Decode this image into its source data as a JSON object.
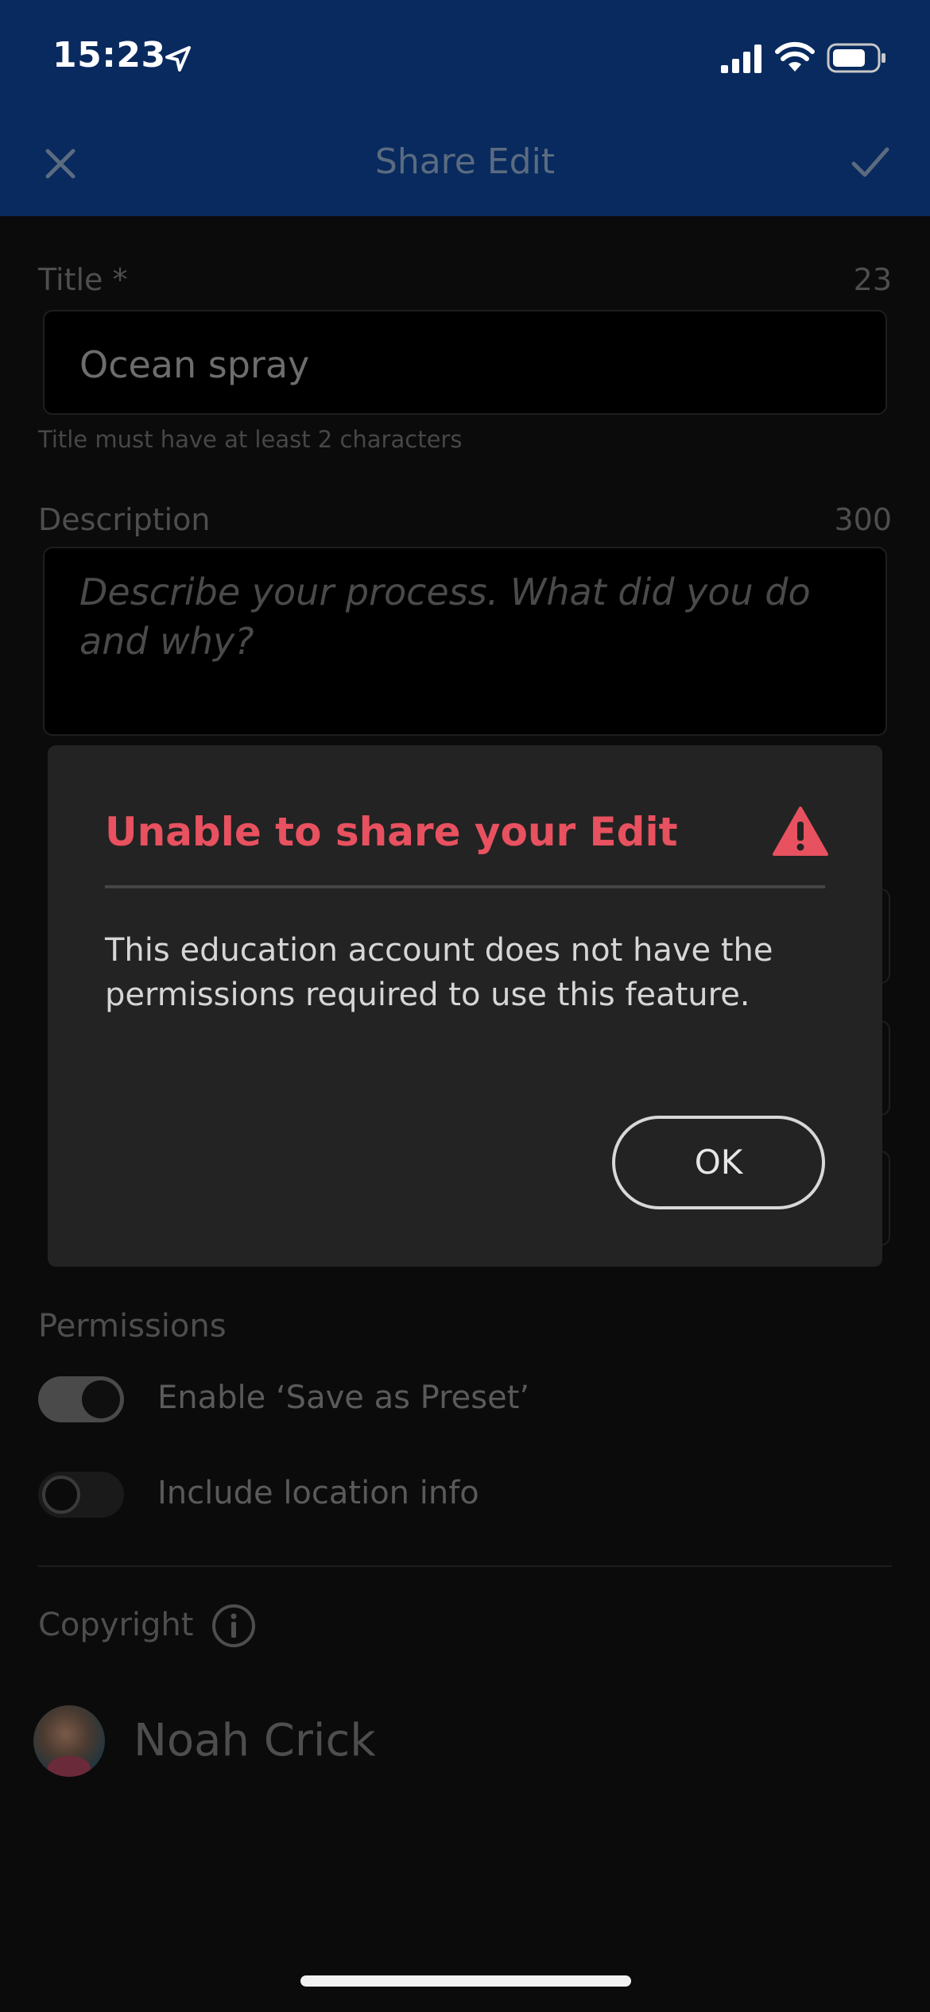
{
  "status_bar": {
    "time": "15:23"
  },
  "nav": {
    "title": "Share Edit",
    "close_icon": "close-icon",
    "confirm_icon": "checkmark-icon"
  },
  "form": {
    "title_label": "Title *",
    "title_counter": "23",
    "title_value": "Ocean spray",
    "title_helper": "Title must have at least 2 characters",
    "description_label": "Description",
    "description_counter": "300",
    "description_placeholder": "Describe your process. What did you do and why?"
  },
  "permissions": {
    "label": "Permissions",
    "save_as_preset": {
      "label": "Enable ‘Save as Preset’",
      "on": true
    },
    "location_info": {
      "label": "Include location info",
      "on": false
    }
  },
  "copyright": {
    "label": "Copyright",
    "owner": "Noah Crick"
  },
  "dialog": {
    "title": "Unable to share your Edit",
    "body": "This education account does not have the permissions required to use this feature.",
    "ok_label": "OK",
    "title_color": "#e8515f"
  },
  "colors": {
    "header": "#082a5e",
    "background": "#0b0b0b",
    "dialog": "#232323"
  }
}
